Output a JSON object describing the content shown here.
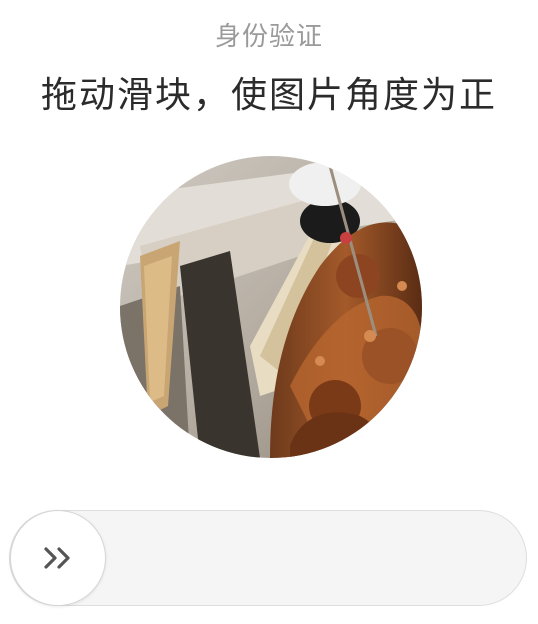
{
  "header": {
    "subtitle": "身份验证",
    "title": "拖动滑块，使图片角度为正"
  },
  "captcha": {
    "image_description_icon": "rotated-statue-photo",
    "slider_icon": "double-chevron-right-icon"
  },
  "colors": {
    "subtitle": "#9a9a9a",
    "title": "#2b2b2b",
    "track_bg": "#f5f5f5",
    "track_border": "#dedede",
    "handle_bg": "#ffffff",
    "chevron": "#555555"
  }
}
